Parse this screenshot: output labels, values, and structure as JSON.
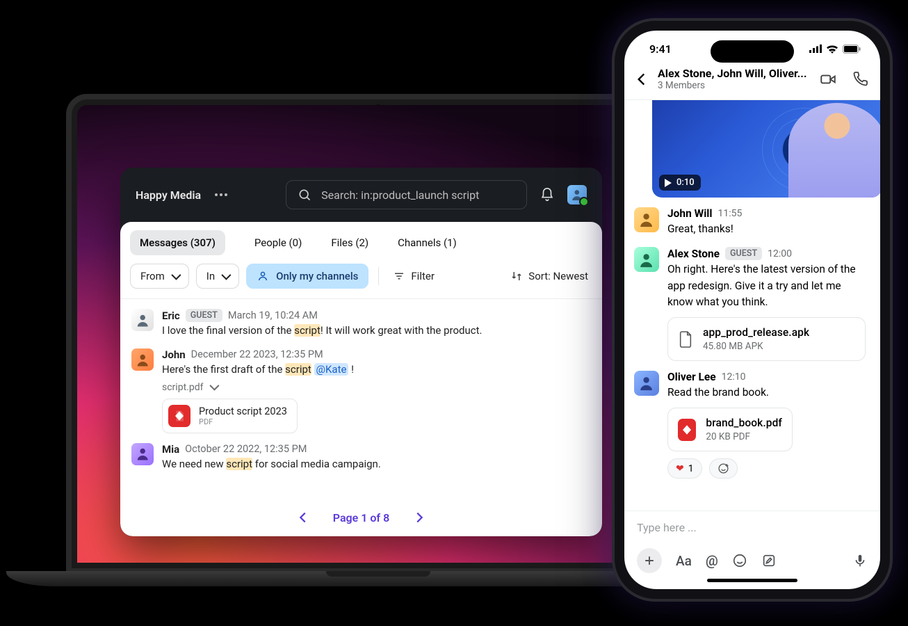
{
  "desktop": {
    "workspace": "Happy Media",
    "search_text": "Search: in:product_launch script",
    "tabs": {
      "messages": "Messages (307)",
      "people": "People (0)",
      "files": "Files (2)",
      "channels": "Channels (1)"
    },
    "filters": {
      "from": "From",
      "in": "In",
      "only_my": "Only my channels",
      "filter": "Filter",
      "sort": "Sort: Newest"
    },
    "messages": [
      {
        "author": "Eric",
        "guest": "GUEST",
        "timestamp": "March 19, 10:24 AM",
        "text_before": "I love the final version of the ",
        "hl": "script",
        "text_after": "! It will work great with the product."
      },
      {
        "author": "John",
        "timestamp": "December 22 2023, 12:35 PM",
        "text_before": "Here's the first draft of the ",
        "hl": "script",
        "text_mid": "  ",
        "mention": "@Kate",
        "text_after": " !",
        "attachment_label": "script.pdf",
        "attachment_title": "Product script 2023",
        "attachment_sub": "PDF"
      },
      {
        "author": "Mia",
        "timestamp": "October 22 2022, 12:35 PM",
        "text_before": "We need new ",
        "hl": "script",
        "text_after": " for social media campaign."
      }
    ],
    "pager": "Page 1 of 8"
  },
  "mobile": {
    "status_time": "9:41",
    "header_title": "Alex Stone, John Will, Oliver...",
    "header_sub": "3 Members",
    "video_duration": "0:10",
    "messages": [
      {
        "author": "John Will",
        "time": "11:55",
        "text": "Great, thanks!"
      },
      {
        "author": "Alex Stone",
        "guest": "GUEST",
        "time": "12:00",
        "text": "Oh right. Here's the latest version of the app redesign. Give it a try and let me know what you think.",
        "file_name": "app_prod_release.apk",
        "file_meta": "45.80 MB APK"
      },
      {
        "author": "Oliver Lee",
        "time": "12:10",
        "text": "Read the brand book.",
        "file_name": "brand_book.pdf",
        "file_meta": "20 KB PDF",
        "reaction_heart_count": "1"
      }
    ],
    "composer_placeholder": "Type here ...",
    "aa_label": "Aa",
    "at_label": "@"
  }
}
